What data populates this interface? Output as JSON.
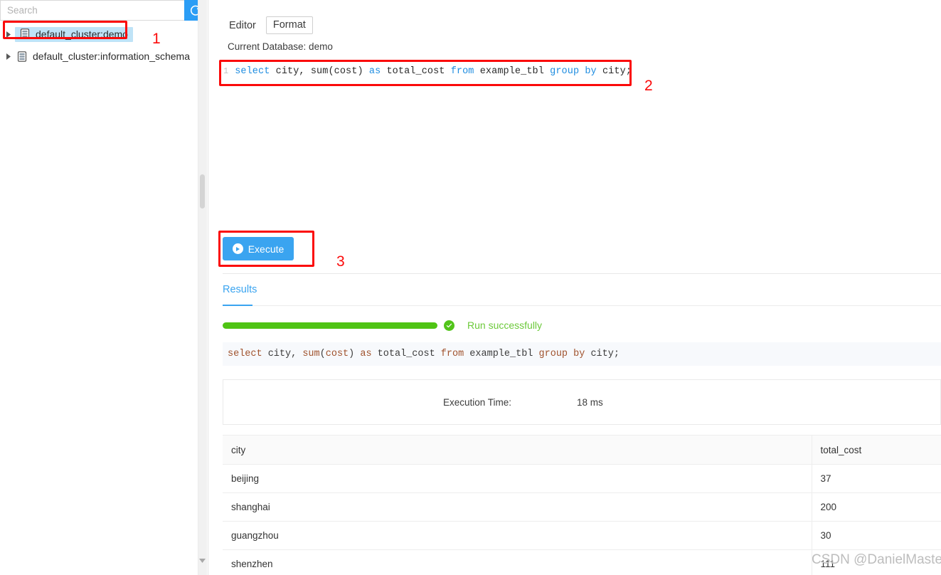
{
  "sidebar": {
    "search": {
      "placeholder": "Search",
      "value": ""
    },
    "refresh_icon": "refresh-icon",
    "tree": [
      {
        "label": "default_cluster:demo",
        "icon": "database-icon",
        "caret": "caret-right-icon",
        "selected": true
      },
      {
        "label": "default_cluster:information_schema",
        "icon": "database-icon",
        "caret": "caret-right-icon",
        "selected": false
      }
    ]
  },
  "editor": {
    "tabs": [
      {
        "label": "Editor",
        "type": "plain"
      },
      {
        "label": "Format",
        "type": "button"
      }
    ],
    "current_database": "Current Database: demo",
    "line_number": "1",
    "sql_tokens": [
      {
        "t": "select",
        "k": "kw"
      },
      {
        "t": " city, ",
        "k": "id"
      },
      {
        "t": "sum",
        "k": "id"
      },
      {
        "t": "(cost) ",
        "k": "id"
      },
      {
        "t": "as",
        "k": "kw"
      },
      {
        "t": " total_cost ",
        "k": "id"
      },
      {
        "t": "from",
        "k": "kw"
      },
      {
        "t": " example_tbl ",
        "k": "id"
      },
      {
        "t": "group",
        "k": "kw"
      },
      {
        "t": " ",
        "k": "id"
      },
      {
        "t": "by",
        "k": "kw"
      },
      {
        "t": " city;",
        "k": "id"
      }
    ],
    "execute_label": "Execute",
    "execute_icon": "play-icon"
  },
  "results": {
    "tab_label": "Results",
    "status_text": "Run successfully",
    "status_icon": "check-circle-icon",
    "progress_percent": 100,
    "sql_tokens": [
      {
        "t": "select",
        "k": "kw"
      },
      {
        "t": " city, ",
        "k": "id"
      },
      {
        "t": "sum",
        "k": "kw"
      },
      {
        "t": "(",
        "k": "id"
      },
      {
        "t": "cost",
        "k": "kw"
      },
      {
        "t": ") ",
        "k": "id"
      },
      {
        "t": "as",
        "k": "kw"
      },
      {
        "t": " total_cost ",
        "k": "id"
      },
      {
        "t": "from",
        "k": "kw"
      },
      {
        "t": " example_tbl ",
        "k": "id"
      },
      {
        "t": "group",
        "k": "kw"
      },
      {
        "t": " ",
        "k": "id"
      },
      {
        "t": "by",
        "k": "kw"
      },
      {
        "t": " city;",
        "k": "id"
      }
    ],
    "execution_time_label": "Execution Time:",
    "execution_time_value": "18 ms",
    "table": {
      "columns": [
        "city",
        "total_cost"
      ],
      "rows": [
        [
          "beijing",
          "37"
        ],
        [
          "shanghai",
          "200"
        ],
        [
          "guangzhou",
          "30"
        ],
        [
          "shenzhen",
          "111"
        ]
      ]
    }
  },
  "annotations": [
    {
      "number": "1"
    },
    {
      "number": "2"
    },
    {
      "number": "3"
    }
  ],
  "watermark": "CSDN @DanielMaster",
  "colors": {
    "accent_blue": "#3aa4f0",
    "refresh_blue": "#2b9df5",
    "success_green": "#52c41a",
    "progress_green": "#4fc414",
    "annotation_red": "#fb0a0a",
    "selection_blue": "#bfe3f7",
    "keyword_blue": "#1d8ce0",
    "keyword_brown": "#a0522d"
  }
}
